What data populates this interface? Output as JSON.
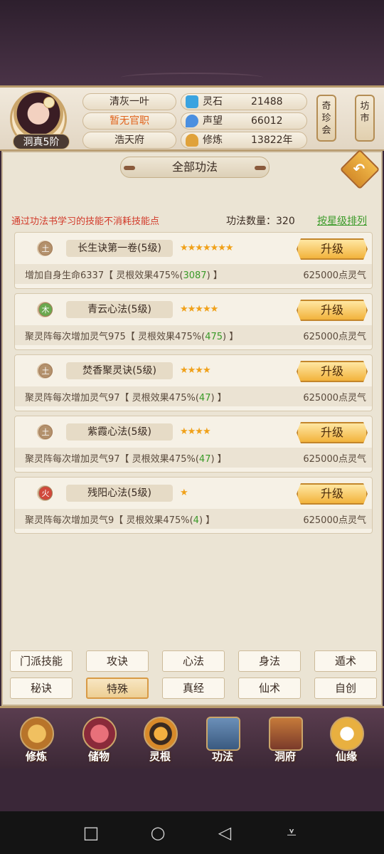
{
  "header": {
    "rank": "洞真5阶",
    "name": "清灰一叶",
    "position": "暂无官职",
    "residence": "浩天府",
    "stats": [
      {
        "label": "灵石",
        "value": "21488",
        "icon": "gem-icon",
        "color": "#3aa3e0"
      },
      {
        "label": "声望",
        "value": "66012",
        "icon": "drop-icon",
        "color": "#4a8fe0"
      },
      {
        "label": "修炼",
        "value": "13822年",
        "icon": "meditation-icon",
        "color": "#e0a23a"
      }
    ],
    "side_buttons": [
      "奇珍会",
      "坊市"
    ]
  },
  "main": {
    "title": "全部功法",
    "notice": "通过功法书学习的技能不消耗技能点",
    "count_label": "功法数量：320",
    "sort_label": "按星级排列"
  },
  "skills": [
    {
      "element": "土",
      "name": "长生诀第一卷(5级)",
      "stars": "★★★★★★★",
      "effect_prefix": "增加自身生命6337【 灵根效果475%(",
      "effect_value": "3087",
      "effect_suffix": ") 】",
      "cost": "625000点灵气",
      "button": "升级"
    },
    {
      "element": "木",
      "name": "青云心法(5级)",
      "stars": "★★★★★",
      "effect_prefix": "聚灵阵每次增加灵气975【 灵根效果475%(",
      "effect_value": "475",
      "effect_suffix": ") 】",
      "cost": "625000点灵气",
      "button": "升级"
    },
    {
      "element": "土",
      "name": "焚香聚灵诀(5级)",
      "stars": "★★★★",
      "effect_prefix": "聚灵阵每次增加灵气97【 灵根效果475%(",
      "effect_value": "47",
      "effect_suffix": ") 】",
      "cost": "625000点灵气",
      "button": "升级"
    },
    {
      "element": "土",
      "name": "紫霞心法(5级)",
      "stars": "★★★★",
      "effect_prefix": "聚灵阵每次增加灵气97【 灵根效果475%(",
      "effect_value": "47",
      "effect_suffix": ") 】",
      "cost": "625000点灵气",
      "button": "升级"
    },
    {
      "element": "火",
      "name": "残阳心法(5级)",
      "stars": "★",
      "effect_prefix": "聚灵阵每次增加灵气9【 灵根效果475%(",
      "effect_value": "4",
      "effect_suffix": ") 】",
      "cost": "625000点灵气",
      "button": "升级"
    }
  ],
  "tabs": [
    [
      "门派技能",
      "攻诀",
      "心法",
      "身法",
      "遁术"
    ],
    [
      "秘诀",
      "特殊",
      "真经",
      "仙术",
      "自创"
    ]
  ],
  "active_tab": "特殊",
  "bottom_nav": [
    "修炼",
    "储物",
    "灵根",
    "功法",
    "洞府",
    "仙缘"
  ],
  "android_nav": [
    "□",
    "○",
    "◁",
    "⩡"
  ]
}
